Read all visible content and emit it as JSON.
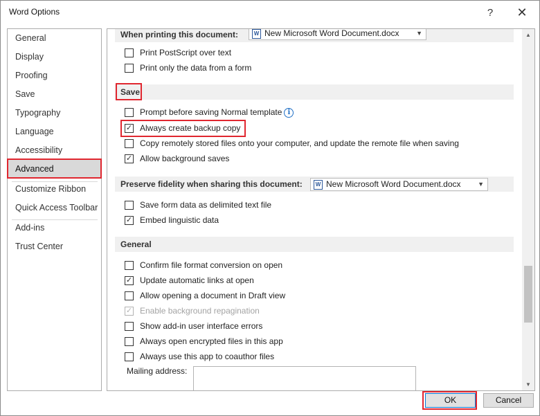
{
  "window": {
    "title": "Word Options",
    "help_glyph": "?",
    "close_glyph": "✕"
  },
  "nav": {
    "items": [
      {
        "label": "General"
      },
      {
        "label": "Display"
      },
      {
        "label": "Proofing"
      },
      {
        "label": "Save"
      },
      {
        "label": "Typography"
      },
      {
        "label": "Language"
      },
      {
        "label": "Accessibility"
      },
      {
        "label": "Advanced",
        "selected": true
      },
      {
        "label": "Customize Ribbon"
      },
      {
        "label": "Quick Access Toolbar"
      },
      {
        "label": "Add-ins"
      },
      {
        "label": "Trust Center"
      }
    ]
  },
  "printing": {
    "header": "When printing this document:",
    "document": "New Microsoft Word Document.docx",
    "options": [
      {
        "label": "Print PostScript over text",
        "checked": false
      },
      {
        "label": "Print only the data from a form",
        "checked": false
      }
    ]
  },
  "save": {
    "header": "Save",
    "options": [
      {
        "label": "Prompt before saving Normal template",
        "checked": false
      },
      {
        "label": "Always create backup copy",
        "checked": true
      },
      {
        "label": "Copy remotely stored files onto your computer, and update the remote file when saving",
        "checked": false
      },
      {
        "label": "Allow background saves",
        "checked": true
      }
    ]
  },
  "fidelity": {
    "header": "Preserve fidelity when sharing this document:",
    "document": "New Microsoft Word Document.docx",
    "options": [
      {
        "label": "Save form data as delimited text file",
        "checked": false
      },
      {
        "label": "Embed linguistic data",
        "checked": true
      }
    ]
  },
  "general": {
    "header": "General",
    "options": [
      {
        "label": "Confirm file format conversion on open",
        "checked": false
      },
      {
        "label": "Update automatic links at open",
        "checked": true
      },
      {
        "label": "Allow opening a document in Draft view",
        "checked": false
      },
      {
        "label": "Enable background repagination",
        "checked": true,
        "disabled": true
      },
      {
        "label": "Show add-in user interface errors",
        "checked": false
      },
      {
        "label": "Always open encrypted files in this app",
        "checked": false
      },
      {
        "label": "Always use this app to coauthor files",
        "checked": false
      }
    ],
    "mailing_label": "Mailing address:",
    "mailing_value": ""
  },
  "check_glyph": "✓",
  "icons": {
    "info": "info-icon",
    "word_doc": "word-document-icon",
    "dropdown": "chevron-down-icon",
    "doc_glyph": "W",
    "dropdown_glyph": "▼",
    "scroll_up_glyph": "▲",
    "scroll_down_glyph": "▼"
  },
  "footer": {
    "ok_label": "OK",
    "cancel_label": "Cancel"
  },
  "colors": {
    "highlight": "#e0262f",
    "selected_nav": "#d9d9d9",
    "section_header": "#f0f0f0"
  }
}
